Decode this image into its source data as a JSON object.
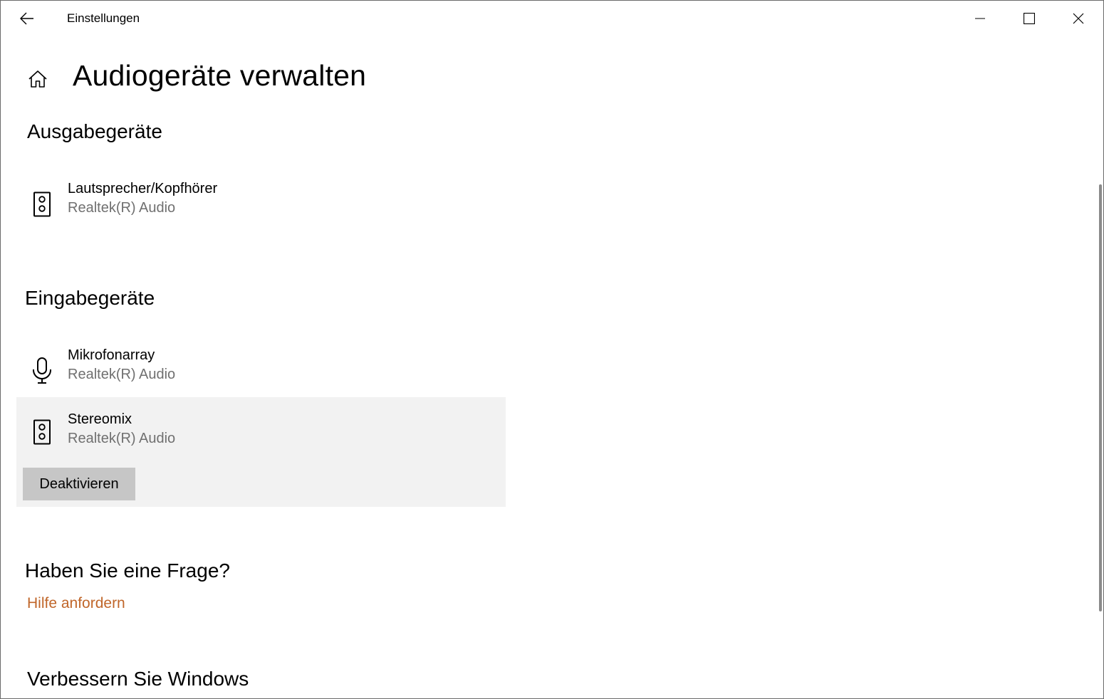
{
  "window": {
    "title": "Einstellungen"
  },
  "page": {
    "title": "Audiogeräte verwalten"
  },
  "output": {
    "heading": "Ausgabegeräte",
    "devices": [
      {
        "name": "Lautsprecher/Kopfhörer",
        "driver": "Realtek(R) Audio",
        "icon": "speaker-icon"
      }
    ]
  },
  "input": {
    "heading": "Eingabegeräte",
    "devices": [
      {
        "name": "Mikrofonarray",
        "driver": "Realtek(R) Audio",
        "icon": "microphone-icon"
      },
      {
        "name": "Stereomix",
        "driver": "Realtek(R) Audio",
        "icon": "speaker-icon",
        "selected": true,
        "action_label": "Deaktivieren"
      }
    ]
  },
  "help": {
    "heading": "Haben Sie eine Frage?",
    "link": "Hilfe anfordern"
  },
  "feedback": {
    "heading": "Verbessern Sie Windows"
  },
  "colors": {
    "link": "#c0662a",
    "selected_bg": "#f2f2f2",
    "button_bg": "#c6c6c6",
    "secondary_text": "#707070"
  }
}
